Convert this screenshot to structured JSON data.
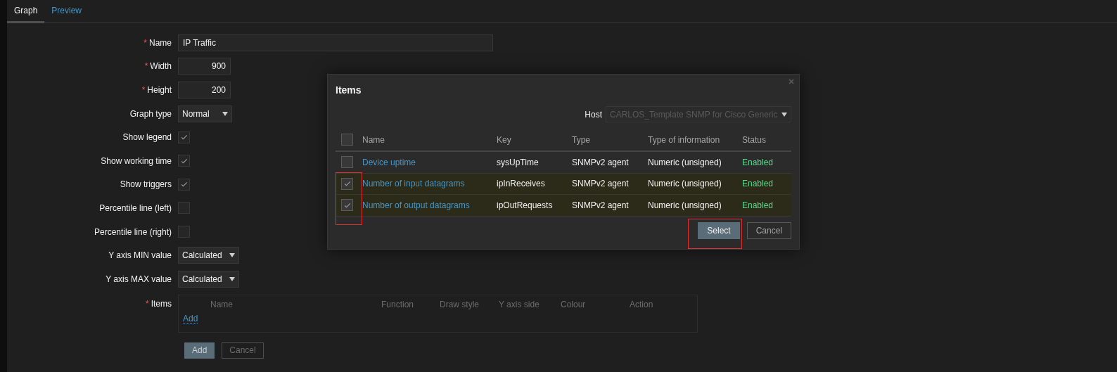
{
  "tabs": [
    {
      "label": "Graph",
      "selected": true
    },
    {
      "label": "Preview",
      "selected": false
    }
  ],
  "form": {
    "fields": [
      {
        "label": "Name",
        "required_mark": "*",
        "kind": "text",
        "value": "IP Traffic"
      },
      {
        "label": "Width",
        "required_mark": "*",
        "kind": "number",
        "value": "900"
      },
      {
        "label": "Height",
        "required_mark": "*",
        "kind": "number",
        "value": "200"
      },
      {
        "label": "Graph type",
        "kind": "select",
        "value": "Normal"
      },
      {
        "label": "Show legend",
        "kind": "checkbox",
        "checked": true
      },
      {
        "label": "Show working time",
        "kind": "checkbox",
        "checked": true
      },
      {
        "label": "Show triggers",
        "kind": "checkbox",
        "checked": true
      },
      {
        "label": "Percentile line (left)",
        "kind": "checkbox",
        "checked": false
      },
      {
        "label": "Percentile line (right)",
        "kind": "checkbox",
        "checked": false
      },
      {
        "label": "Y axis MIN value",
        "kind": "select",
        "value": "Calculated"
      },
      {
        "label": "Y axis MAX value",
        "kind": "select",
        "value": "Calculated"
      }
    ],
    "items": {
      "label": "Items",
      "required_mark": "*",
      "columns": [
        "Name",
        "Function",
        "Draw style",
        "Y axis side",
        "Colour",
        "Action"
      ],
      "add_link": "Add"
    },
    "buttons": [
      {
        "label": "Add",
        "kind": "primary"
      },
      {
        "label": "Cancel",
        "kind": "secondary"
      }
    ]
  },
  "modal": {
    "title": "Items",
    "host_label": "Host",
    "host_value": "CARLOS_Template SNMP for Cisco Generic",
    "select_all_checked": false,
    "columns": [
      "Name",
      "Key",
      "Type",
      "Type of information",
      "Status"
    ],
    "rows": [
      {
        "name": "Device uptime",
        "key": "sysUpTime",
        "type": "SNMPv2 agent",
        "info": "Numeric (unsigned)",
        "status": "Enabled",
        "checked": false
      },
      {
        "name": "Number of input datagrams",
        "key": "ipInReceives",
        "type": "SNMPv2 agent",
        "info": "Numeric (unsigned)",
        "status": "Enabled",
        "checked": true
      },
      {
        "name": "Number of output datagrams",
        "key": "ipOutRequests",
        "type": "SNMPv2 agent",
        "info": "Numeric (unsigned)",
        "status": "Enabled",
        "checked": true
      }
    ],
    "buttons": [
      {
        "label": "Select",
        "kind": "primary",
        "highlighted": true
      },
      {
        "label": "Cancel",
        "kind": "secondary",
        "highlighted": false
      }
    ],
    "checked_rows_highlighted": true
  }
}
